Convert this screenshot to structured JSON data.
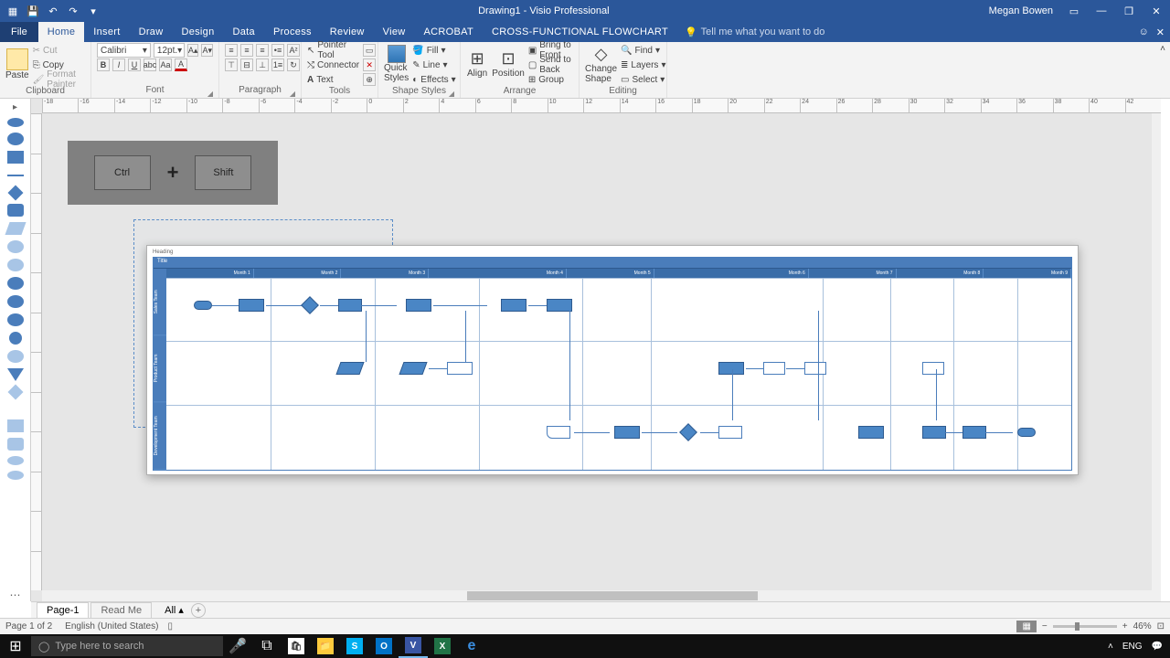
{
  "app": {
    "title": "Drawing1 - Visio Professional",
    "user": "Megan Bowen"
  },
  "tabs": {
    "file": "File",
    "list": [
      "Home",
      "Insert",
      "Draw",
      "Design",
      "Data",
      "Process",
      "Review",
      "View",
      "ACROBAT",
      "CROSS-FUNCTIONAL FLOWCHART"
    ],
    "active": "Home",
    "tellme": "Tell me what you want to do"
  },
  "ribbon": {
    "clipboard": {
      "paste": "Paste",
      "cut": "Cut",
      "copy": "Copy",
      "format_painter": "Format Painter",
      "caption": "Clipboard"
    },
    "font": {
      "name": "Calibri",
      "size": "12pt.",
      "caption": "Font"
    },
    "paragraph": {
      "caption": "Paragraph"
    },
    "tools": {
      "pointer": "Pointer Tool",
      "connector": "Connector",
      "text": "Text",
      "caption": "Tools"
    },
    "shape_styles": {
      "quick": "Quick Styles",
      "fill": "Fill",
      "line": "Line",
      "effects": "Effects",
      "caption": "Shape Styles"
    },
    "arrange": {
      "align": "Align",
      "position": "Position",
      "bring_front": "Bring to Front",
      "send_back": "Send to Back",
      "group": "Group",
      "caption": "Arrange"
    },
    "editing": {
      "change": "Change Shape",
      "find": "Find",
      "layers": "Layers",
      "select": "Select",
      "caption": "Editing"
    }
  },
  "overlay": {
    "key1": "Ctrl",
    "plus": "+",
    "key2": "Shift"
  },
  "flowchart": {
    "heading": "Heading",
    "title": "Title",
    "months": [
      "Month 1",
      "Month 2",
      "Month 3",
      "Month 4",
      "Month 5",
      "Month 6",
      "Month 7",
      "Month 8",
      "Month 9"
    ],
    "lanes": [
      "Sales Team",
      "Product Team",
      "Development Team"
    ]
  },
  "pagetabs": {
    "page1": "Page-1",
    "readme": "Read Me",
    "all": "All"
  },
  "status": {
    "page": "Page 1 of 2",
    "lang": "English (United States)",
    "zoom": "46%"
  },
  "taskbar": {
    "search": "Type here to search",
    "lang": "ENG"
  }
}
